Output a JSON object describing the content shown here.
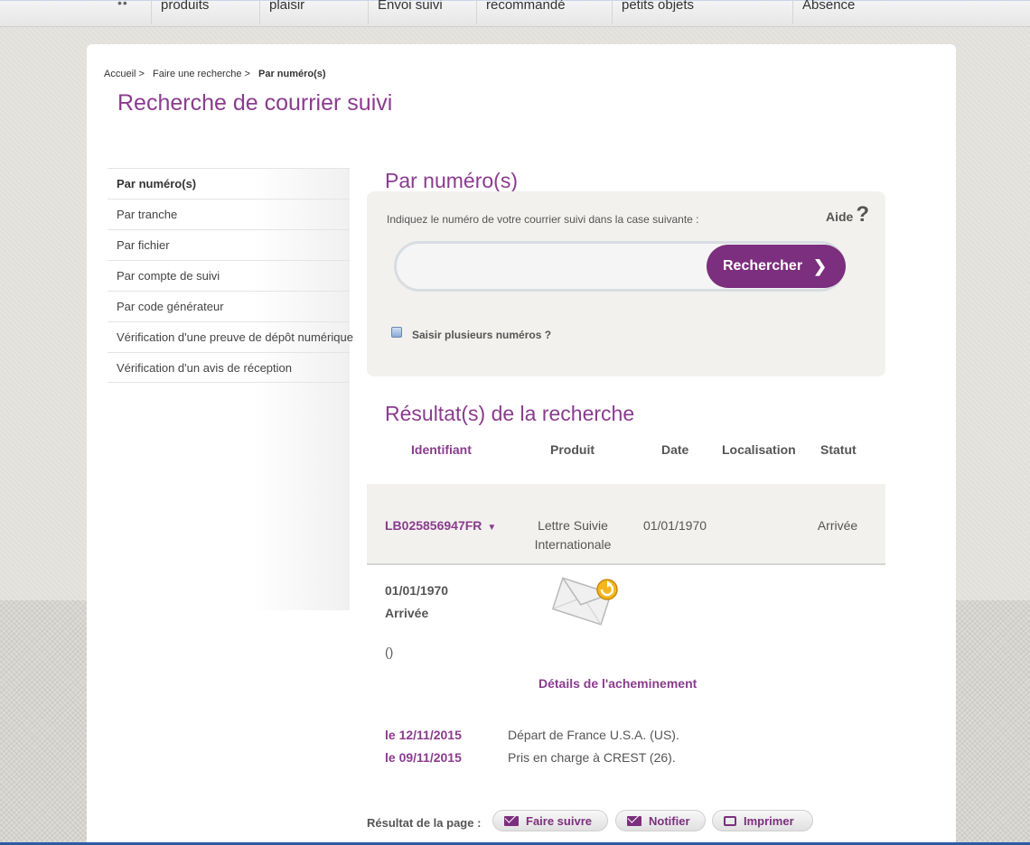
{
  "nav": {
    "dots": "••",
    "items": [
      "produits",
      "plaisir",
      "Envoi suivi",
      "recommandé",
      "petits objets",
      "Absence"
    ]
  },
  "breadcrumb": {
    "home": "Accueil >",
    "search": "Faire une recherche >",
    "current": "Par numéro(s)"
  },
  "page_title": "Recherche de courrier suivi",
  "sidebar": {
    "items": [
      "Par numéro(s)",
      "Par tranche",
      "Par fichier",
      "Par compte de suivi",
      "Par code générateur",
      "Vérification d'une preuve de dépôt numérique",
      "Vérification d'un avis de réception"
    ]
  },
  "search": {
    "title": "Par numéro(s)",
    "hint": "Indiquez le numéro de votre courrier suivi dans la case suivante :",
    "help_label": "Aide",
    "help_icon": "?",
    "input_value": "",
    "button_label": "Rechercher",
    "button_icon": "❯",
    "multi_label": "Saisir plusieurs numéros ?"
  },
  "results": {
    "title": "Résultat(s) de la recherche",
    "columns": [
      "Identifiant",
      "Produit",
      "Date",
      "Localisation",
      "Statut"
    ],
    "row": {
      "id": "LB025856947FR",
      "dropdown_icon": "▼",
      "product_line1": "Lettre Suivie",
      "product_line2": "Internationale",
      "date": "01/01/1970",
      "location": "",
      "status": "Arrivée"
    },
    "detail": {
      "date": "01/01/1970",
      "status": "Arrivée",
      "extra": "()"
    }
  },
  "routing": {
    "title": "Détails de l'acheminement",
    "events": [
      {
        "date": "le 12/11/2015",
        "text": "Départ de France  U.S.A. (US)."
      },
      {
        "date": "le 09/11/2015",
        "text": "Pris en charge à CREST (26)."
      }
    ]
  },
  "footer": {
    "label": "Résultat de la page :",
    "buttons": [
      "Faire suivre",
      "Notifier",
      "Imprimer"
    ]
  },
  "colors": {
    "accent": "#8a3c8e",
    "button": "#7c2f7e"
  }
}
